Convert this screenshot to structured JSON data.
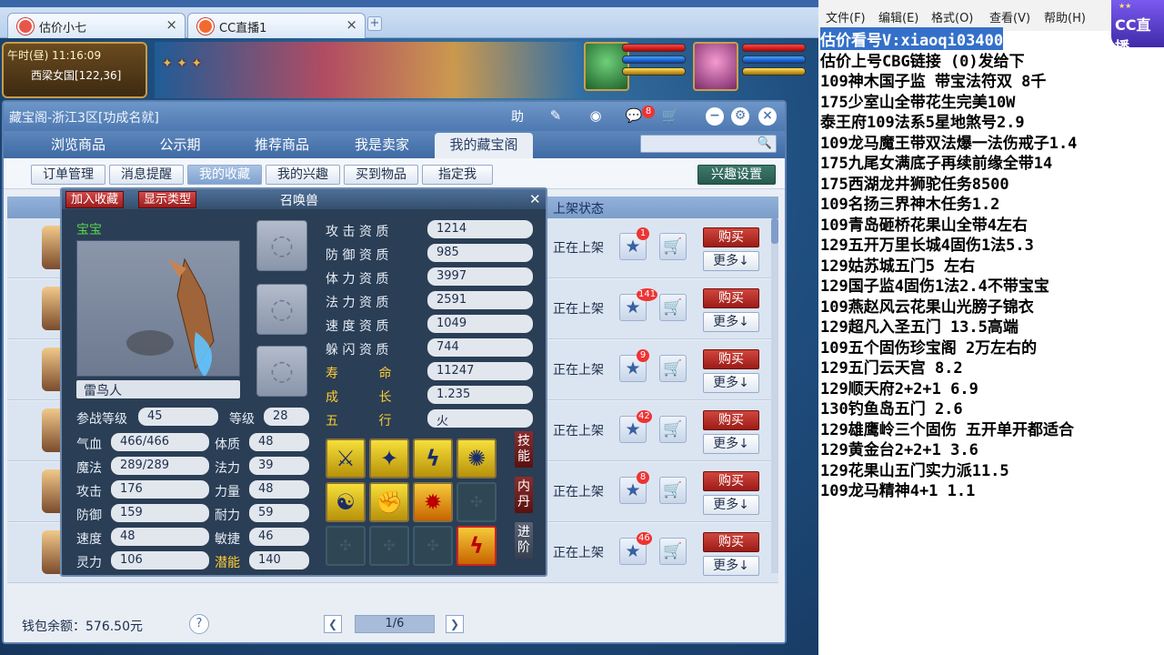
{
  "browser": {
    "tabs": [
      {
        "label": "估价小七"
      },
      {
        "label": "CC直播1"
      }
    ],
    "new_tab": "+"
  },
  "game_hud": {
    "time": "午时(昼)  11:16:09",
    "location": "西梁女国[122,36]"
  },
  "window": {
    "title": "藏宝阁-浙江3区[功成名就]",
    "help_icon": "助",
    "mail_badge": "8",
    "nav_tabs": [
      "浏览商品",
      "公示期",
      "推荐商品",
      "我是卖家",
      "我的藏宝阁"
    ],
    "active_nav": 4,
    "search_placeholder": "",
    "sub_buttons": [
      "订单管理",
      "消息提醒",
      "我的收藏",
      "我的兴趣",
      "买到物品",
      "指定我"
    ],
    "active_sub": 2,
    "interest_settings": "兴趣设置",
    "list_header_status": "上架状态"
  },
  "list_rows": [
    {
      "status": "正在上架",
      "count": "1",
      "buy": "购买",
      "more": "更多↓"
    },
    {
      "status": "正在上架",
      "count": "141",
      "buy": "购买",
      "more": "更多↓"
    },
    {
      "status": "正在上架",
      "count": "9",
      "buy": "购买",
      "more": "更多↓"
    },
    {
      "status": "正在上架",
      "count": "42",
      "buy": "购买",
      "more": "更多↓"
    },
    {
      "status": "正在上架",
      "count": "8",
      "buy": "购买",
      "more": "更多↓"
    },
    {
      "status": "正在上架",
      "count": "46",
      "buy": "购买",
      "more": "更多↓"
    }
  ],
  "footer": {
    "wallet": "钱包余额：576.50元",
    "help": "?",
    "page": "1/6"
  },
  "pet": {
    "title": "召唤兽",
    "add_favorite": "加入收藏",
    "show_type": "显示类型",
    "type": "宝宝",
    "name": "雷鸟人",
    "battle_level_label": "参战等级",
    "battle_level": "45",
    "level_label": "等级",
    "level": "28",
    "stats_left": [
      {
        "label": "气血",
        "value": "466/466"
      },
      {
        "label": "魔法",
        "value": "289/289"
      },
      {
        "label": "攻击",
        "value": "176"
      },
      {
        "label": "防御",
        "value": "159"
      },
      {
        "label": "速度",
        "value": "48"
      },
      {
        "label": "灵力",
        "value": "106"
      }
    ],
    "stats_right": [
      {
        "label": "体质",
        "value": "48"
      },
      {
        "label": "法力",
        "value": "39"
      },
      {
        "label": "力量",
        "value": "48"
      },
      {
        "label": "耐力",
        "value": "59"
      },
      {
        "label": "敏捷",
        "value": "46"
      },
      {
        "label": "潜能",
        "value": "140"
      }
    ],
    "aptitudes": [
      {
        "label": "攻 击 资 质",
        "value": "1214"
      },
      {
        "label": "防 御 资 质",
        "value": "985"
      },
      {
        "label": "体 力 资 质",
        "value": "3997"
      },
      {
        "label": "法 力 资 质",
        "value": "2591"
      },
      {
        "label": "速 度 资 质",
        "value": "1049"
      },
      {
        "label": "躲 闪 资 质",
        "value": "744"
      }
    ],
    "life_label": "寿          命",
    "life": "11247",
    "growth_label": "成          长",
    "growth": "1.235",
    "element_label": "五          行",
    "element": "火",
    "side_skill": "技能",
    "side_core": "内丹",
    "side_advance": "进阶"
  },
  "notepad": {
    "menu": [
      "文件(F)",
      "编辑(E)",
      "格式(O)",
      "查看(V)",
      "帮助(H)"
    ],
    "lines": [
      "估价看号V:xiaoqi03400",
      "估价上号CBG链接  (0)发给下",
      "109神木国子监 带宝法符双 8千",
      "175少室山全带花生完美10W",
      "泰王府109法系5星地煞号2.9",
      "109龙马魔王带双法爆一法伤戒子1.4",
      "175九尾女满底子再续前缘全带14",
      "175西湖龙井狮驼任务8500",
      "109名扬三界神木任务1.2",
      "109青岛砸桥花果山全带4左右",
      "129五开万里长城4固伤1法5.3",
      "129姑苏城五门5 左右",
      "129国子监4固伤1法2.4不带宝宝",
      "109燕赵风云花果山光膀子锦衣",
      "129超凡入圣五门  13.5高端",
      "109五个固伤珍宝阁 2万左右的",
      "129五门云天宫 8.2",
      "129顺天府2+2+1  6.9",
      "130钓鱼岛五门  2.6",
      "129雄鹰岭三个固伤 五开单开都适合",
      "129黄金台2+2+1 3.6",
      "129花果山五门实力派11.5",
      "109龙马精神4+1  1.1"
    ],
    "logo": "CC直播"
  }
}
